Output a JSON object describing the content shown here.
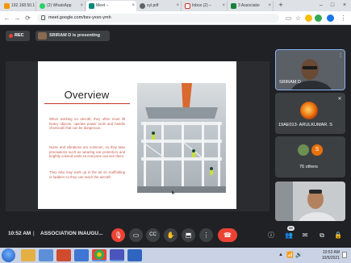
{
  "browser": {
    "tabs": [
      {
        "label": "192.168.50.1",
        "active": false
      },
      {
        "label": "(2) WhatsApp",
        "active": false
      },
      {
        "label": "Meet – ",
        "active": true
      },
      {
        "label": "syl.pdf",
        "active": false
      },
      {
        "label": "Inbox (2) – ",
        "active": false
      },
      {
        "label": "3 Associatio",
        "active": false
      }
    ],
    "new_tab": "+",
    "url": "meet.google.com/bsv-yxxn-ymh"
  },
  "meet": {
    "rec_label": "REC",
    "presenter_label": "SRIRAM D is presenting",
    "slide": {
      "title": "Overview",
      "paragraphs": [
        "When working on aircraft, they often must lift heavy objects, operate power tools and handle chemicals that can be dangerous.",
        "Noise and vibrations are common, so they take precautions such as wearing ear protection and brightly colored vests so everyone can see them.",
        "They also may work up in the air on scaffolding or ladders so they can reach the aircraft."
      ]
    },
    "participants": [
      {
        "name": "SRIRAM D"
      },
      {
        "name": "19AE013- ARULKUMAR. S"
      },
      {
        "name": "76 others",
        "avatar_letter": "S"
      },
      {
        "name": ""
      }
    ],
    "time": "10:52 AM",
    "separator": "|",
    "meeting_name": "ASSOCIATION INAUGU...",
    "participant_count": "80"
  },
  "taskbar": {
    "clock_time": "10:52 AM",
    "clock_date": "10/5/2021"
  },
  "colors": {
    "meet_bg": "#202124",
    "accent_red": "#ea4335",
    "slide_text": "#c45a4a"
  }
}
